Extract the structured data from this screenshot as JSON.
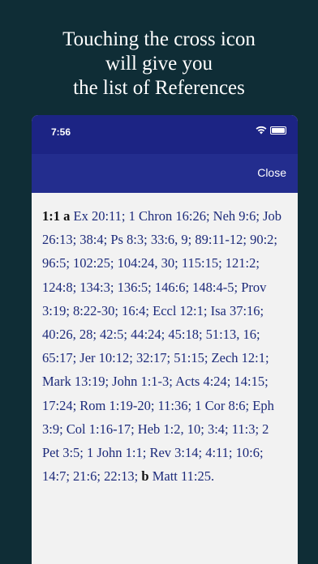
{
  "caption": {
    "line1": "Touching the cross icon",
    "line2": "will give you",
    "line3": "the list of References"
  },
  "status_bar": {
    "time": "7:56"
  },
  "nav": {
    "close_label": "Close"
  },
  "references": {
    "verse": "1:1",
    "note_a": "a",
    "refs_a": "Ex 20:11; 1 Chron 16:26; Neh 9:6; Job 26:13; 38:4; Ps 8:3; 33:6, 9; 89:11-12; 90:2; 96:5; 102:25; 104:24, 30; 115:15; 121:2; 124:8; 134:3; 136:5; 146:6; 148:4-5; Prov 3:19; 8:22-30; 16:4; Eccl 12:1; Isa 37:16; 40:26, 28; 42:5; 44:24; 45:18; 51:13, 16; 65:17; Jer 10:12; 32:17; 51:15; Zech 12:1; Mark 13:19; John 1:1-3; Acts 4:24; 14:15; 17:24; Rom 1:19-20; 11:36; 1 Cor 8:6; Eph 3:9; Col 1:16-17; Heb 1:2, 10; 3:4; 11:3; 2 Pet 3:5; 1 John 1:1; Rev 3:14; 4:11; 10:6; 14:7; 21:6; 22:13;",
    "note_b": "b",
    "refs_b": "Matt 11:25."
  }
}
